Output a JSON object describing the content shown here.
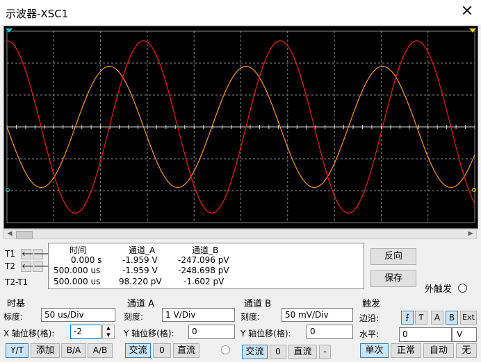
{
  "window": {
    "title": "示波器-XSC1"
  },
  "measure": {
    "t1": "T1",
    "t2": "T2",
    "t2t1": "T2-T1",
    "h_time": "时间",
    "h_a": "通道_A",
    "h_b": "通道_B",
    "rows": [
      {
        "time": "0.000 s",
        "a": "-1.959 V",
        "b": "-247.096 pV"
      },
      {
        "time": "500.000 us",
        "a": "-1.959 V",
        "b": "-248.698 pV"
      },
      {
        "time": "500.000 us",
        "a": "98.220 pV",
        "b": "-1.602 pV"
      }
    ]
  },
  "buttons": {
    "reverse": "反向",
    "save": "保存",
    "ext_trigger": "外触发"
  },
  "timebase": {
    "title": "时基",
    "scale_label": "标度:",
    "scale": "50 us/Div",
    "xpos_label": "X 轴位移(格):",
    "xpos": "-2",
    "yt": "Y/T",
    "add": "添加",
    "ba": "B/A",
    "ab": "A/B"
  },
  "channel_a": {
    "title": "通道 A",
    "scale_label": "刻度:",
    "scale": "1  V/Div",
    "ypos_label": "Y 轴位移(格):",
    "ypos": "0",
    "ac": "交流",
    "zero": "0",
    "dc": "直流"
  },
  "channel_b": {
    "title": "通道 B",
    "scale_label": "刻度:",
    "scale": "50 mV/Div",
    "ypos_label": "Y 轴位移(格):",
    "ypos": "0",
    "ac": "交流",
    "zero": "0",
    "dc": "直流",
    "minus": "-"
  },
  "trigger": {
    "title": "触发",
    "edge_label": "边沿:",
    "level_label": "水平:",
    "a": "A",
    "b": "B",
    "ext": "Ext",
    "level": "0",
    "unit": "V",
    "single": "单次",
    "normal": "正常",
    "auto": "自动",
    "none": "无"
  },
  "scope": {
    "grid_color": "#8c8c8c",
    "wave_a_color": "#e8201c",
    "wave_b_color": "#f29a2c",
    "wave_a_amplitude_div": 2.7,
    "wave_b_amplitude_div": 1.9,
    "period_div": 2.92,
    "wave_a_phase_div": 0.0,
    "wave_b_phase_div": 0.73
  }
}
